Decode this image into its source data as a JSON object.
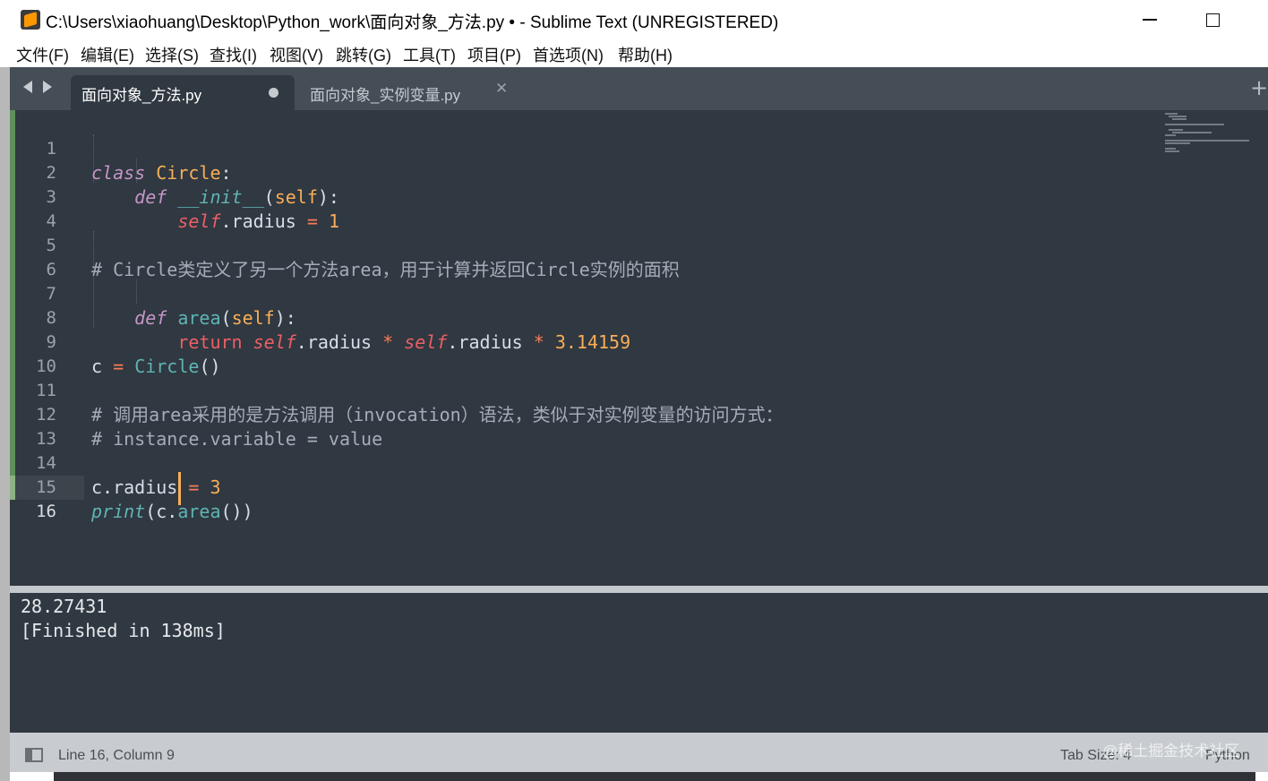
{
  "window": {
    "title": "C:\\Users\\xiaohuang\\Desktop\\Python_work\\面向对象_方法.py • - Sublime Text (UNREGISTERED)"
  },
  "menu": [
    "文件(F)",
    "编辑(E)",
    "选择(S)",
    "查找(I)",
    "视图(V)",
    "跳转(G)",
    "工具(T)",
    "项目(P)",
    "首选项(N)",
    "帮助(H)"
  ],
  "tabs": [
    {
      "label": "面向对象_方法.py",
      "active": true,
      "dirty": true
    },
    {
      "label": "面向对象_实例变量.py",
      "active": false,
      "close_icon": "close-icon"
    }
  ],
  "editor": {
    "line_numbers": [
      "1",
      "2",
      "3",
      "4",
      "5",
      "6",
      "7",
      "8",
      "9",
      "10",
      "11",
      "12",
      "13",
      "14",
      "15",
      "16"
    ],
    "current_line": 16,
    "code_lines": [
      "class Circle:",
      "    def __init__(self):",
      "        self.radius = 1",
      "",
      "# Circle类定义了另一个方法area，用于计算并返回Circle实例的面积",
      "",
      "    def area(self):",
      "        return self.radius * self.radius * 3.14159",
      "c = Circle()",
      "",
      "# 调用area采用的是方法调用（invocation）语法，类似于对实例变量的访问方式：",
      "# instance.variable = value",
      "",
      "c.radius = 3",
      "print(c.area())",
      ""
    ]
  },
  "console": {
    "lines": [
      "28.27431",
      "[Finished in 138ms]"
    ]
  },
  "status": {
    "position": "Line 16, Column 9",
    "tab_size": "Tab Size: 4",
    "syntax": "Python",
    "watermark": "@稀土掘金技术社区"
  },
  "colors": {
    "background": "#303841",
    "keyword": "#c695c6",
    "class_name": "#f9ae58",
    "function": "#5fb4b4",
    "self": "#ec5f66",
    "comment": "#a6acb9"
  }
}
